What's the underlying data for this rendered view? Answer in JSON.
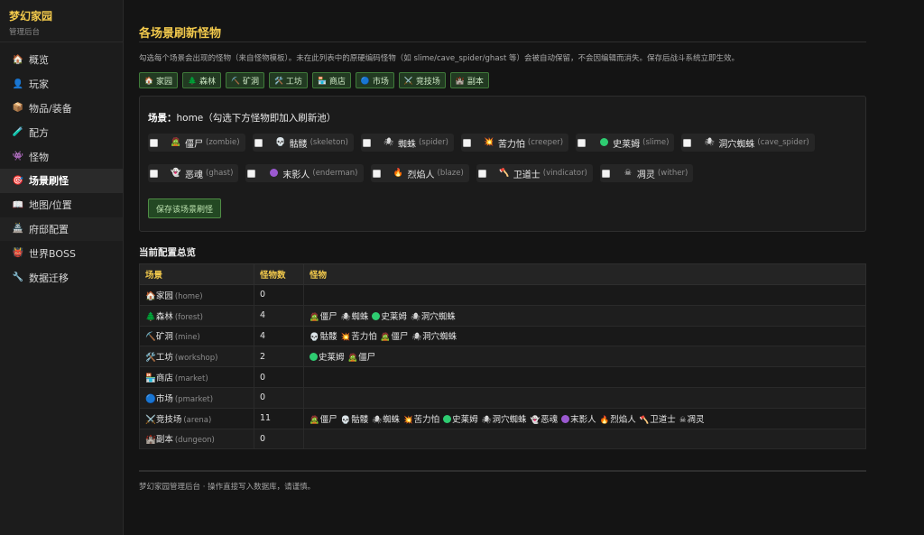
{
  "brand": {
    "title": "梦幻家园",
    "subtitle": "管理后台"
  },
  "nav": [
    {
      "icon": "🏠",
      "label": "概览",
      "icon_name": "house-icon"
    },
    {
      "icon": "👤",
      "label": "玩家",
      "icon_name": "player-icon"
    },
    {
      "icon": "📦",
      "label": "物品/装备",
      "icon_name": "box-icon"
    },
    {
      "icon": "🧪",
      "label": "配方",
      "icon_name": "flask-icon"
    },
    {
      "icon": "👾",
      "label": "怪物",
      "icon_name": "monster-icon"
    },
    {
      "icon": "🎯",
      "label": "场景刷怪",
      "icon_name": "target-icon",
      "active": true
    },
    {
      "icon": "📖",
      "label": "地图/位置",
      "icon_name": "map-icon"
    },
    {
      "icon": "🏯",
      "label": "府邸配置",
      "icon_name": "mansion-icon"
    },
    {
      "icon": "👹",
      "label": "世界BOSS",
      "icon_name": "boss-icon"
    },
    {
      "icon": "🔧",
      "label": "数据迁移",
      "icon_name": "wrench-icon"
    }
  ],
  "page": {
    "title": "各场景刷新怪物",
    "description": "勾选每个场景会出现的怪物（来自怪物模板）。未在此列表中的原硬编码怪物（如 slime/cave_spider/ghast 等）会被自动保留，不会因编辑而消失。保存后战斗系统立即生效。"
  },
  "scene_tabs": [
    {
      "icon": "🏠",
      "label": "家园"
    },
    {
      "icon": "🌲",
      "label": "森林"
    },
    {
      "icon": "⛏️",
      "label": "矿洞"
    },
    {
      "icon": "🛠️",
      "label": "工坊"
    },
    {
      "icon": "🏪",
      "label": "商店"
    },
    {
      "icon": "🔵",
      "label": "市场"
    },
    {
      "icon": "⚔️",
      "label": "竞技场"
    },
    {
      "icon": "🏰",
      "label": "副本"
    }
  ],
  "editor": {
    "scene_label": "场景：",
    "scene_id": "home",
    "hint": "（勾选下方怪物即加入刷新池）",
    "row1": [
      {
        "icon": "🧟",
        "name": "僵尸",
        "id": "(zombie)",
        "checked": false
      },
      {
        "icon": "💀",
        "name": "骷髅",
        "id": "(skeleton)",
        "checked": false
      },
      {
        "icon": "🕷",
        "name": "蜘蛛",
        "id": "(spider)",
        "checked": false
      },
      {
        "icon": "💥",
        "name": "苦力怕",
        "id": "(creeper)",
        "checked": false
      },
      {
        "icon": "●",
        "name": "史莱姆",
        "id": "(slime)",
        "checked": false,
        "color": "#2ecc71"
      },
      {
        "icon": "🕷",
        "name": "洞穴蜘蛛",
        "id": "(cave_spider)",
        "checked": false
      }
    ],
    "row2": [
      {
        "icon": "👻",
        "name": "恶魂",
        "id": "(ghast)",
        "checked": false
      },
      {
        "icon": "●",
        "name": "末影人",
        "id": "(enderman)",
        "checked": false,
        "color": "#9b59d0"
      },
      {
        "icon": "🔥",
        "name": "烈焰人",
        "id": "(blaze)",
        "checked": false
      },
      {
        "icon": "🪓",
        "name": "卫道士",
        "id": "(vindicator)",
        "checked": false
      },
      {
        "icon": "☠",
        "name": "凋灵",
        "id": "(wither)",
        "checked": false
      }
    ],
    "save_label": "保存该场景刷怪"
  },
  "summary": {
    "title": "当前配置总览",
    "headers": [
      "场景",
      "怪物数",
      "怪物"
    ],
    "rows": [
      {
        "icon": "🏠",
        "name": "家园",
        "id": "(home)",
        "count": "0",
        "monsters": []
      },
      {
        "icon": "🌲",
        "name": "森林",
        "id": "(forest)",
        "count": "4",
        "monsters": [
          {
            "icon": "🧟",
            "name": "僵尸"
          },
          {
            "icon": "🕷",
            "name": "蜘蛛"
          },
          {
            "icon": "●",
            "name": "史莱姆",
            "color": "#2ecc71"
          },
          {
            "icon": "🕷",
            "name": "洞穴蜘蛛"
          }
        ]
      },
      {
        "icon": "⛏️",
        "name": "矿洞",
        "id": "(mine)",
        "count": "4",
        "monsters": [
          {
            "icon": "💀",
            "name": "骷髅"
          },
          {
            "icon": "💥",
            "name": "苦力怕"
          },
          {
            "icon": "🧟",
            "name": "僵尸"
          },
          {
            "icon": "🕷",
            "name": "洞穴蜘蛛"
          }
        ]
      },
      {
        "icon": "🛠️",
        "name": "工坊",
        "id": "(workshop)",
        "count": "2",
        "monsters": [
          {
            "icon": "●",
            "name": "史莱姆",
            "color": "#2ecc71"
          },
          {
            "icon": "🧟",
            "name": "僵尸"
          }
        ]
      },
      {
        "icon": "🏪",
        "name": "商店",
        "id": "(market)",
        "count": "0",
        "monsters": []
      },
      {
        "icon": "🔵",
        "name": "市场",
        "id": "(pmarket)",
        "count": "0",
        "monsters": []
      },
      {
        "icon": "⚔️",
        "name": "竞技场",
        "id": "(arena)",
        "count": "11",
        "monsters": [
          {
            "icon": "🧟",
            "name": "僵尸"
          },
          {
            "icon": "💀",
            "name": "骷髅"
          },
          {
            "icon": "🕷",
            "name": "蜘蛛"
          },
          {
            "icon": "💥",
            "name": "苦力怕"
          },
          {
            "icon": "●",
            "name": "史莱姆",
            "color": "#2ecc71"
          },
          {
            "icon": "🕷",
            "name": "洞穴蜘蛛"
          },
          {
            "icon": "👻",
            "name": "恶魂"
          },
          {
            "icon": "●",
            "name": "末影人",
            "color": "#9b59d0"
          },
          {
            "icon": "🔥",
            "name": "烈焰人"
          },
          {
            "icon": "🪓",
            "name": "卫道士"
          },
          {
            "icon": "☠",
            "name": "凋灵"
          }
        ]
      },
      {
        "icon": "🏰",
        "name": "副本",
        "id": "(dungeon)",
        "count": "0",
        "monsters": []
      }
    ]
  },
  "footer": "梦幻家园管理后台 · 操作直接写入数据库，请谨慎。",
  "colors": {
    "accent": "#f2c94c",
    "button_green": "#4f8c45",
    "background": "#141414"
  }
}
